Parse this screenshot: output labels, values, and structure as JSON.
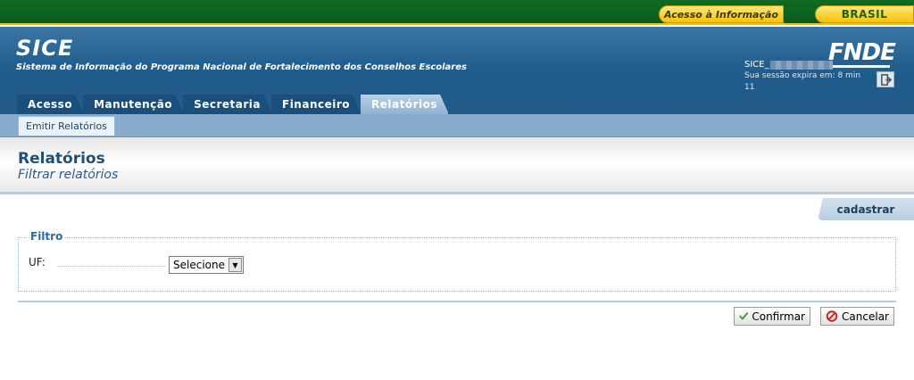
{
  "gov_bar": {
    "access_info": "Acesso à Informação",
    "brasil": "BRASIL"
  },
  "header": {
    "title": "SICE",
    "subtitle": "Sistema de Informação do Programa Nacional de Fortalecimento dos Conselhos Escolares",
    "logo": "FNDE"
  },
  "session": {
    "user": "SICE_",
    "expiry": "Sua sessão expira em: 8 min 11"
  },
  "tabs": [
    {
      "label": "Acesso",
      "active": false
    },
    {
      "label": "Manutenção",
      "active": false
    },
    {
      "label": "Secretaria",
      "active": false
    },
    {
      "label": "Financeiro",
      "active": false
    },
    {
      "label": "Relatórios",
      "active": true
    }
  ],
  "subnav": {
    "item": "Emitir Relatórios"
  },
  "page": {
    "title": "Relatórios",
    "subtitle": "Filtrar relatórios"
  },
  "actions": {
    "cadastrar": "cadastrar"
  },
  "filter": {
    "legend": "Filtro",
    "uf_label": "UF:",
    "uf_selected": "Selecione"
  },
  "buttons": {
    "confirm": "Confirmar",
    "cancel": "Cancelar"
  },
  "colors": {
    "header_blue": "#1d5a8b",
    "gov_green": "#0a5a1b",
    "accent_yellow": "#f5c400"
  },
  "icons": {
    "logout": "logout-icon",
    "confirm": "check-icon",
    "cancel": "cancel-icon"
  }
}
